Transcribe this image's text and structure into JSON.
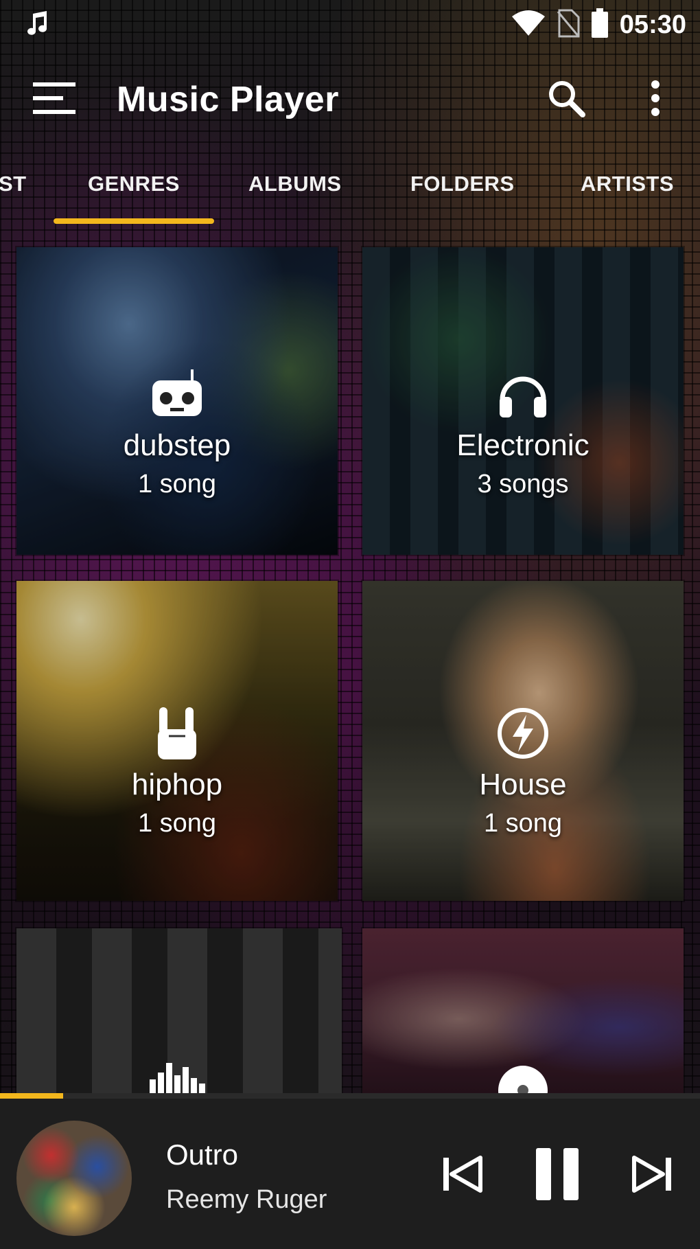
{
  "status_bar": {
    "time": "05:30",
    "icons": [
      "music-note-icon",
      "wifi-icon",
      "no-sim-icon",
      "battery-icon"
    ]
  },
  "toolbar": {
    "title": "Music Player",
    "icons": [
      "menu-icon",
      "search-icon",
      "more-vert-icon"
    ]
  },
  "tabs": {
    "items": [
      "ST",
      "GENRES",
      "ALBUMS",
      "FOLDERS",
      "ARTISTS"
    ],
    "selected": "GENRES",
    "accent_color": "#f3b71d"
  },
  "genres": [
    {
      "name": "dubstep",
      "count": "1 song",
      "icon": "robot-icon"
    },
    {
      "name": "Electronic",
      "count": "3 songs",
      "icon": "headphones-icon"
    },
    {
      "name": "hiphop",
      "count": "1 song",
      "icon": "rock-hand-icon"
    },
    {
      "name": "House",
      "count": "1 song",
      "icon": "lightning-icon"
    },
    {
      "name": "",
      "count": "",
      "icon": "equalizer-icon"
    },
    {
      "name": "",
      "count": "",
      "icon": "disc-icon"
    }
  ],
  "now_playing": {
    "title": "Outro",
    "artist": "Reemy Ruger",
    "progress": 0.09,
    "controls": [
      "previous-icon",
      "pause-icon",
      "next-icon"
    ]
  }
}
